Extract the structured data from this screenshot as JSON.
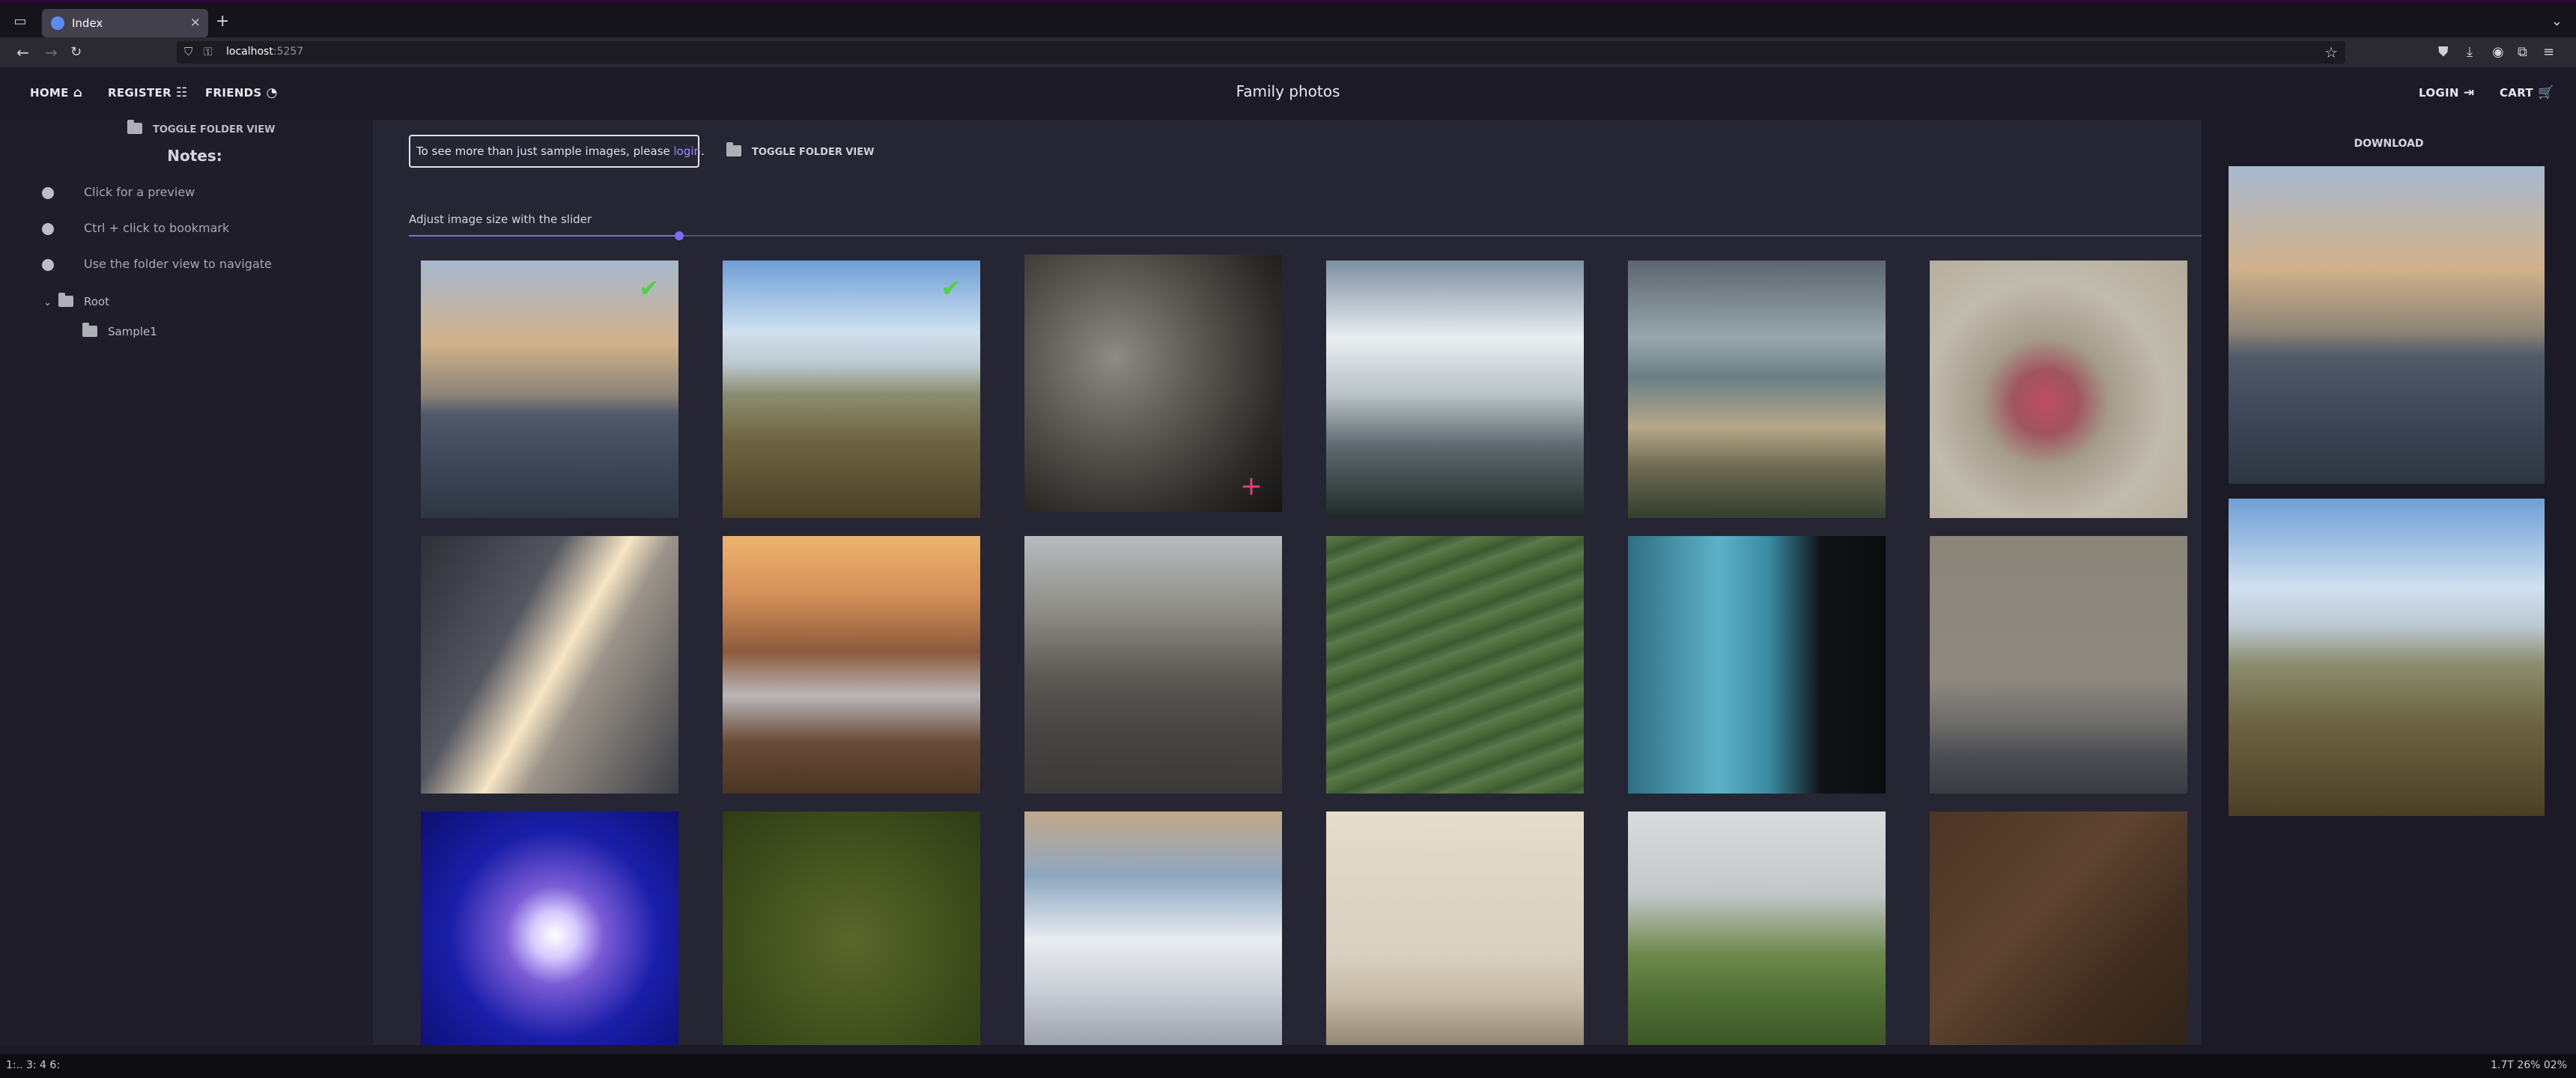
{
  "browser": {
    "tab_title": "Index",
    "url_host": "localhost",
    "url_port": ":5257"
  },
  "app": {
    "title": "Family photos",
    "nav": {
      "home": "HOME",
      "register": "REGISTER",
      "friends": "FRIENDS",
      "login": "LOGIN",
      "cart": "CART"
    }
  },
  "sidebar": {
    "toggle_folder": "TOGGLE FOLDER VIEW",
    "notes_title": "Notes:",
    "notes": [
      "Click for a preview",
      "Ctrl + click to bookmark",
      "Use the folder view to navigate"
    ],
    "tree": {
      "root": "Root",
      "child": "Sample1"
    }
  },
  "main": {
    "login_hint_prefix": "To see more than just sample images, please ",
    "login_link": "login",
    "login_hint_suffix": ".",
    "toggle_folder": "TOGGLE FOLDER VIEW",
    "slider_label": "Adjust image size with the slider",
    "slider_value": 0.151
  },
  "photos": [
    {
      "id": "sea",
      "checked": true
    },
    {
      "id": "swing",
      "checked": true
    },
    {
      "id": "car",
      "plus": true
    },
    {
      "id": "fog"
    },
    {
      "id": "beach"
    },
    {
      "id": "monkey"
    },
    {
      "id": "station"
    },
    {
      "id": "road"
    },
    {
      "id": "street"
    },
    {
      "id": "tea"
    },
    {
      "id": "phone"
    },
    {
      "id": "city"
    },
    {
      "id": "fireworks"
    },
    {
      "id": "moss"
    },
    {
      "id": "clouds"
    },
    {
      "id": "post"
    },
    {
      "id": "cliffs"
    },
    {
      "id": "tools"
    }
  ],
  "preview": {
    "download_label": "DOWNLOAD",
    "items": [
      "sea",
      "swing"
    ]
  },
  "taskbar": {
    "workspaces": "1:..   3:  4   6:",
    "tray": "1.7T   26%   02%"
  },
  "colors": {
    "accent": "#7c6cf6",
    "link": "#9c8cff",
    "check": "#4fd14b",
    "bookmark": "#e0407a"
  }
}
